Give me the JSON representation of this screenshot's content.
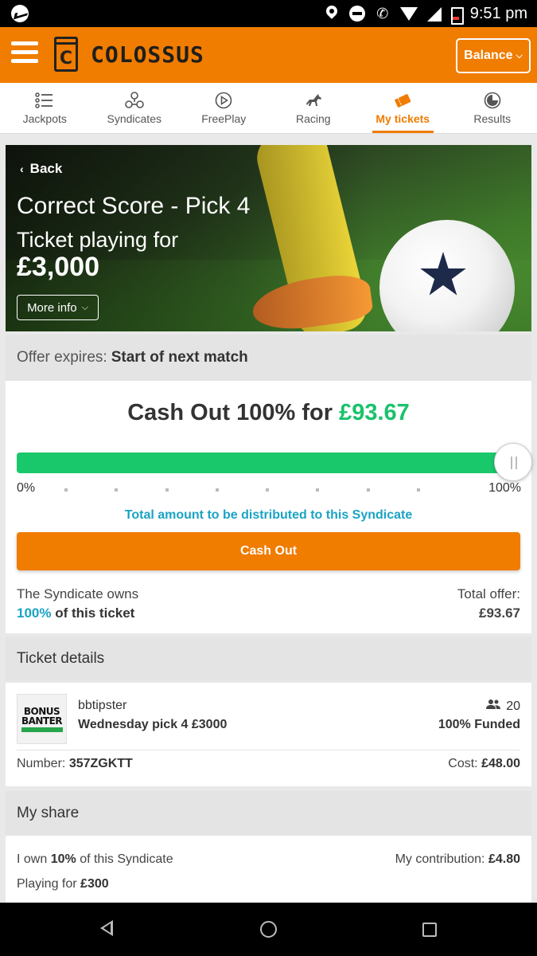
{
  "status_bar": {
    "time": "9:51 pm"
  },
  "header": {
    "brand": "COLOSSUS",
    "logo_letter": "C",
    "balance_label": "Balance"
  },
  "nav": {
    "tabs": [
      {
        "label": "Jackpots",
        "icon": "list-icon",
        "active": false
      },
      {
        "label": "Syndicates",
        "icon": "syndicate-icon",
        "active": false
      },
      {
        "label": "FreePlay",
        "icon": "play-circle-icon",
        "active": false
      },
      {
        "label": "Racing",
        "icon": "horse-icon",
        "active": false
      },
      {
        "label": "My tickets",
        "icon": "ticket-icon",
        "active": true
      },
      {
        "label": "Results",
        "icon": "results-icon",
        "active": false
      }
    ]
  },
  "hero": {
    "back_label": "Back",
    "title": "Correct Score - Pick 4",
    "subtitle": "Ticket playing for",
    "amount": "£3,000",
    "more_info_label": "More info"
  },
  "offer": {
    "expires_label": "Offer expires:",
    "expires_value": "Start of next match"
  },
  "cash_out": {
    "title_prefix": "Cash Out 100% for",
    "amount": "£93.67",
    "progress_percent": 100,
    "scale_min": "0%",
    "scale_max": "100%",
    "distribution_note": "Total amount to be distributed to this Syndicate",
    "button_label": "Cash Out",
    "owns_label": "The Syndicate owns",
    "owns_percent": "100%",
    "owns_suffix": "of this ticket",
    "total_offer_label": "Total offer:",
    "total_offer_value": "£93.67"
  },
  "ticket_details": {
    "heading": "Ticket details",
    "logo_line1": "BONUS",
    "logo_line2": "BANTER",
    "username": "bbtipster",
    "ticket_name": "Wednesday pick 4 £3000",
    "members": "20",
    "funded": "100% Funded",
    "number_label": "Number:",
    "number_value": "357ZGKTT",
    "cost_label": "Cost:",
    "cost_value": "£48.00"
  },
  "my_share": {
    "heading": "My share",
    "own_prefix": "I own",
    "own_percent": "10%",
    "own_suffix": "of this Syndicate",
    "playing_prefix": "Playing for",
    "playing_value": "£300",
    "contribution_label": "My contribution:",
    "contribution_value": "£4.80"
  },
  "colors": {
    "brand_orange": "#f07c00",
    "success_green": "#19c26b",
    "accent_blue": "#1aa3c4"
  }
}
